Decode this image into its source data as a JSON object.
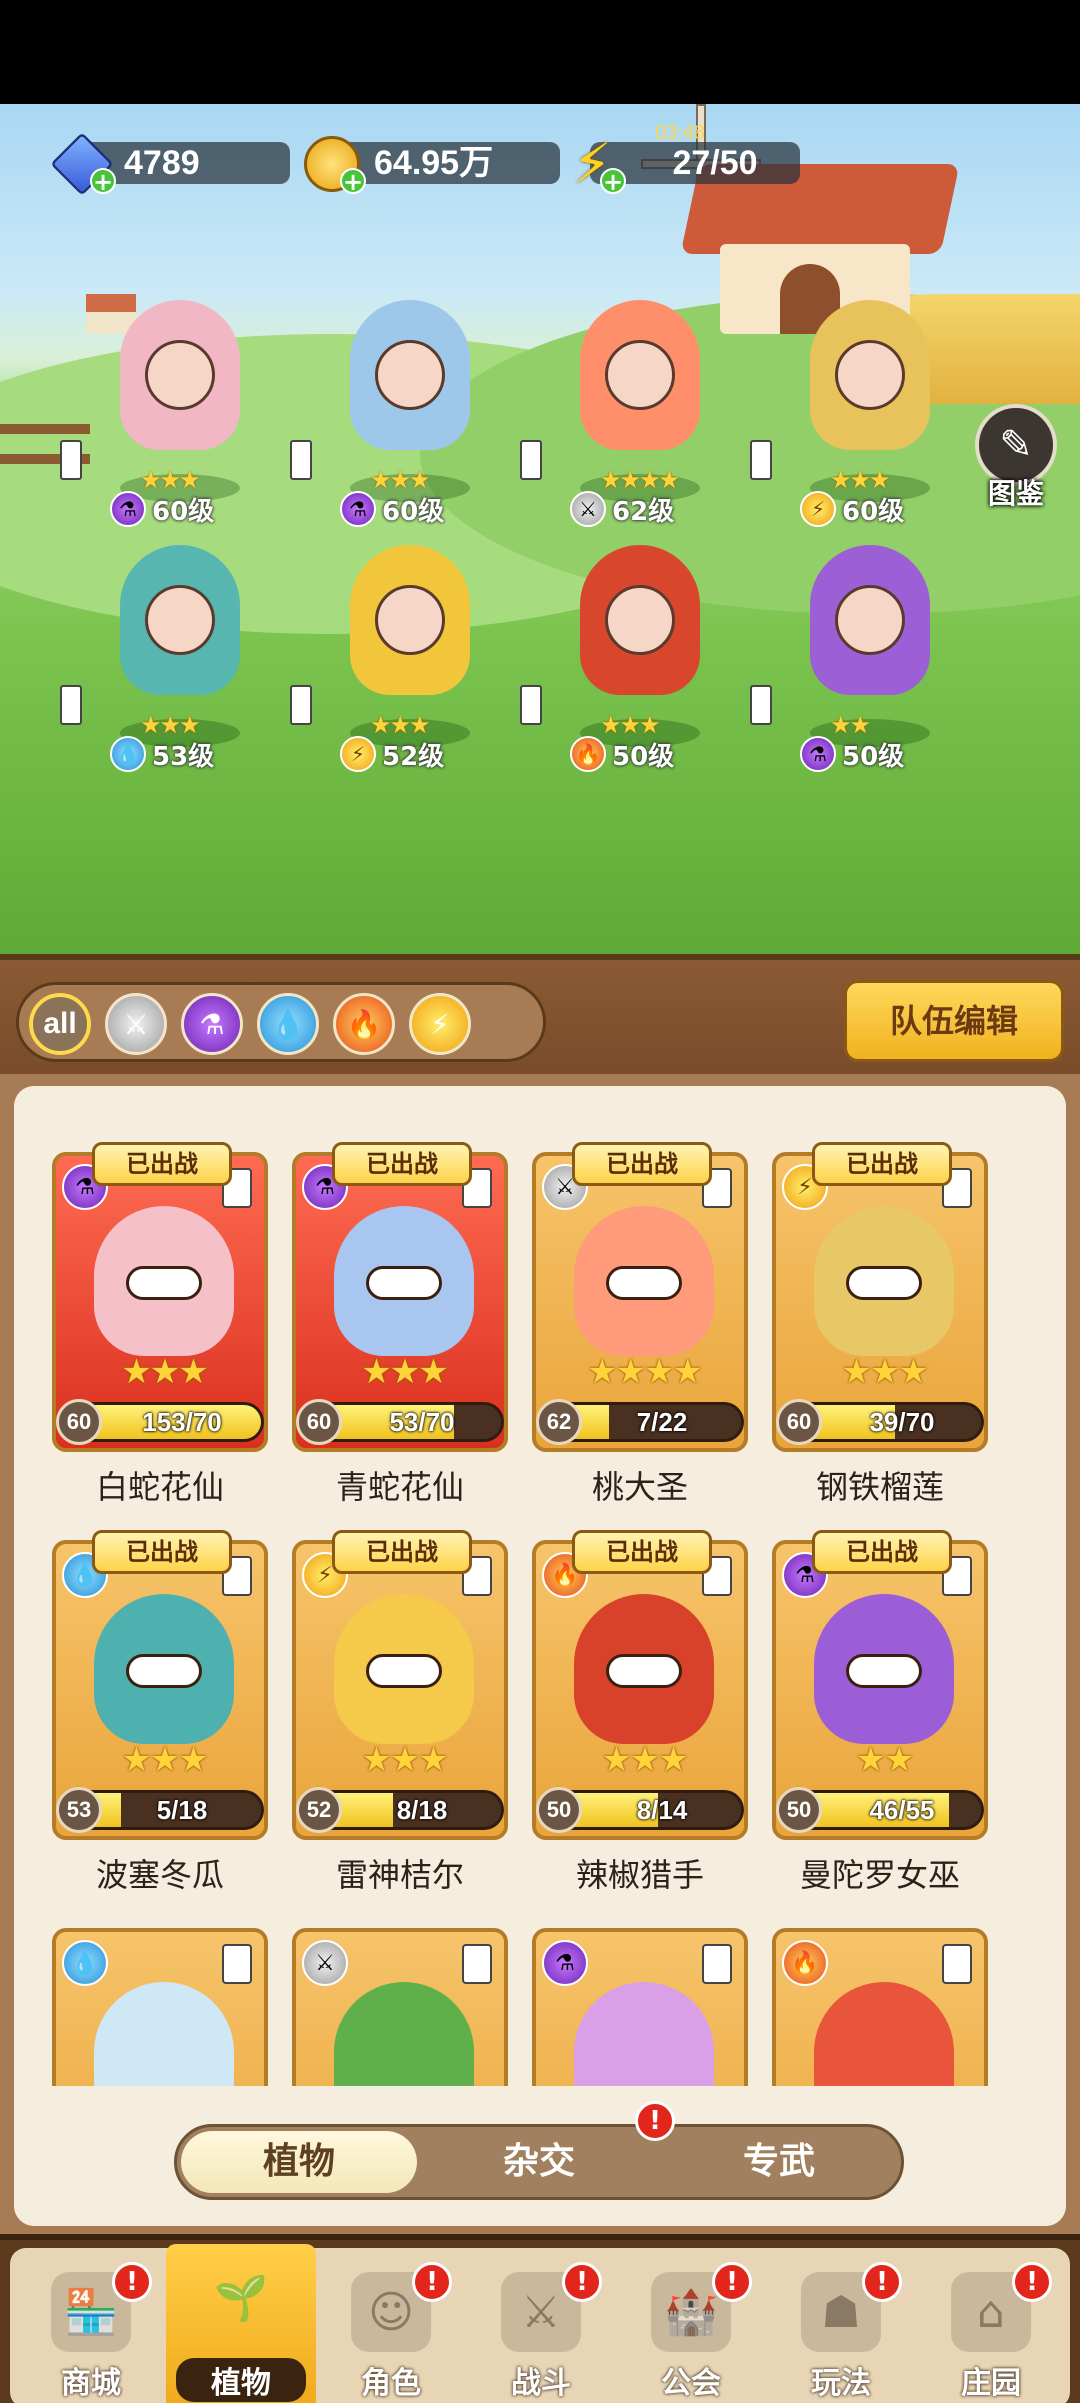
{
  "status_time": "03:48",
  "currency": {
    "gems": "4789",
    "coins": "64.95万",
    "energy": "27/50"
  },
  "codex_label": "图鉴",
  "field_heroes": [
    {
      "level": "60级",
      "element": "magic",
      "stars": 3
    },
    {
      "level": "60级",
      "element": "magic",
      "stars": 3
    },
    {
      "level": "62级",
      "element": "sword",
      "stars": 4
    },
    {
      "level": "60级",
      "element": "thunder",
      "stars": 3
    },
    {
      "level": "53级",
      "element": "water",
      "stars": 3
    },
    {
      "level": "52级",
      "element": "thunder",
      "stars": 3
    },
    {
      "level": "50级",
      "element": "fire",
      "stars": 3
    },
    {
      "level": "50级",
      "element": "magic",
      "stars": 2
    }
  ],
  "filters": {
    "all_label": "all",
    "icons": [
      "sword-icon",
      "potion-icon",
      "water-drop-icon",
      "fire-icon",
      "lightning-icon"
    ]
  },
  "team_edit_label": "队伍编辑",
  "deployed_label": "已出战",
  "cards": [
    {
      "name": "白蛇花仙",
      "level": "60",
      "progress": "153/70",
      "fill": 1.0,
      "stars": "★★★",
      "element": "magic",
      "color": "red",
      "deployed": true
    },
    {
      "name": "青蛇花仙",
      "level": "60",
      "progress": "53/70",
      "fill": 0.757,
      "stars": "★★★",
      "element": "magic",
      "color": "red",
      "deployed": true
    },
    {
      "name": "桃大圣",
      "level": "62",
      "progress": "7/22",
      "fill": 0.318,
      "stars": "★★★★",
      "element": "sword",
      "color": "gold",
      "deployed": true
    },
    {
      "name": "钢铁榴莲",
      "level": "60",
      "progress": "39/70",
      "fill": 0.557,
      "stars": "★★★",
      "element": "thunder",
      "color": "gold",
      "deployed": true
    },
    {
      "name": "波塞冬瓜",
      "level": "53",
      "progress": "5/18",
      "fill": 0.278,
      "stars": "★★★",
      "element": "water",
      "color": "gold",
      "deployed": true
    },
    {
      "name": "雷神桔尔",
      "level": "52",
      "progress": "8/18",
      "fill": 0.444,
      "stars": "★★★",
      "element": "thunder",
      "color": "gold",
      "deployed": true
    },
    {
      "name": "辣椒猎手",
      "level": "50",
      "progress": "8/14",
      "fill": 0.571,
      "stars": "★★★",
      "element": "fire",
      "color": "gold",
      "deployed": true
    },
    {
      "name": "曼陀罗女巫",
      "level": "50",
      "progress": "46/55",
      "fill": 0.836,
      "stars": "★★",
      "element": "magic",
      "color": "gold",
      "deployed": true
    }
  ],
  "partial_cards": [
    {
      "element": "water"
    },
    {
      "element": "sword"
    },
    {
      "element": "magic"
    },
    {
      "element": "fire"
    }
  ],
  "subtabs": [
    "植物",
    "杂交",
    "专武"
  ],
  "subtab_badge": "!",
  "nav": [
    {
      "label": "商城",
      "icon": "shop-icon",
      "badge": "!"
    },
    {
      "label": "植物",
      "icon": "plant-icon",
      "badge": "",
      "active": true
    },
    {
      "label": "角色",
      "icon": "character-icon",
      "badge": "!"
    },
    {
      "label": "战斗",
      "icon": "battle-icon",
      "badge": "!"
    },
    {
      "label": "公会",
      "icon": "guild-icon",
      "badge": "!"
    },
    {
      "label": "玩法",
      "icon": "gameplay-icon",
      "badge": "!"
    },
    {
      "label": "庄园",
      "icon": "manor-icon",
      "badge": "!"
    }
  ]
}
